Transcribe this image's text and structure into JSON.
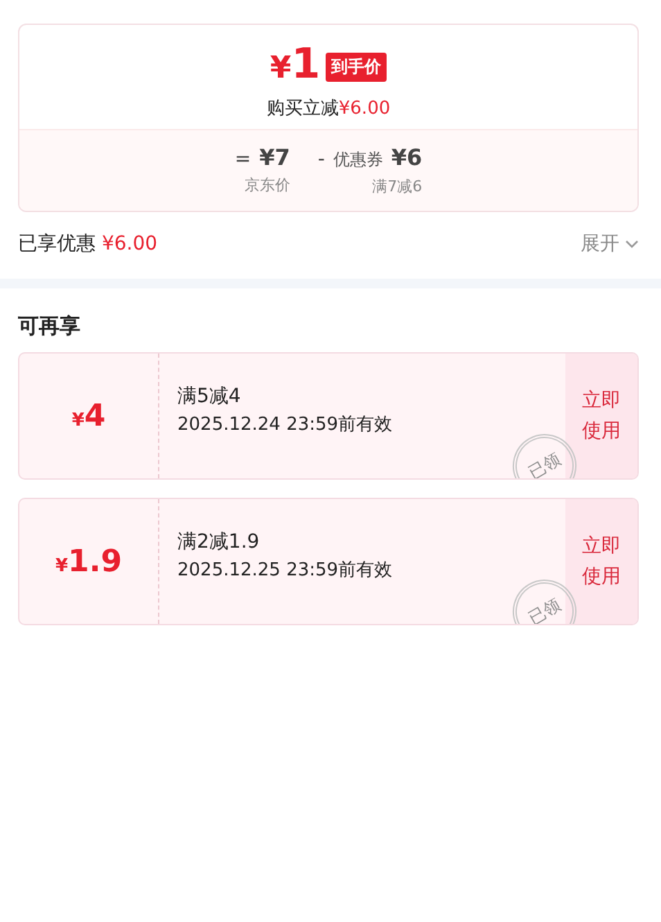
{
  "summary": {
    "price_symbol": "¥",
    "price": "1",
    "badge": "到手价",
    "reduction_label": "购买立减",
    "reduction": "¥6.00",
    "formula": [
      {
        "op": "=",
        "amount": "¥7",
        "note": "京东价"
      },
      {
        "op": "-",
        "label": "优惠券",
        "amount": "¥6",
        "note": "满7减6"
      }
    ]
  },
  "enjoyed": {
    "label": "已享优惠",
    "amount": "¥6.00",
    "toggle": "展开",
    "expanded": false
  },
  "section_title": "可再享",
  "coupons": [
    {
      "symbol": "¥",
      "amount": "4",
      "title": "满5减4",
      "validity": "2025.12.24 23:59前有效",
      "stamp": "已领",
      "button": "立即使用"
    },
    {
      "symbol": "¥",
      "amount": "1.9",
      "title": "满2减1.9",
      "validity": "2025.12.25 23:59前有效",
      "stamp": "已领",
      "button": "立即使用"
    }
  ]
}
